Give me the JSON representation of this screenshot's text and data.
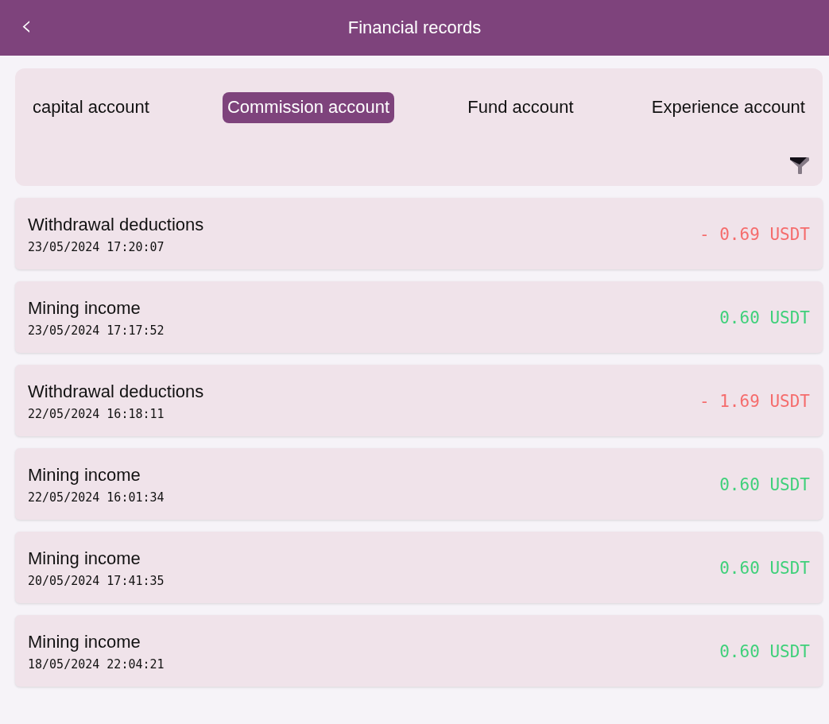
{
  "header": {
    "back": "‹",
    "title": "Financial records"
  },
  "tabs": [
    {
      "label": "capital account",
      "selected": false
    },
    {
      "label": "Commission account",
      "selected": true
    },
    {
      "label": "Fund account",
      "selected": false
    },
    {
      "label": "Experience account",
      "selected": false
    }
  ],
  "records": [
    {
      "title": "Withdrawal deductions",
      "date": "23/05/2024 17:20:07",
      "amount": "- 0.69 USDT",
      "kind": "debit"
    },
    {
      "title": "Mining income",
      "date": "23/05/2024 17:17:52",
      "amount": "0.60 USDT",
      "kind": "credit"
    },
    {
      "title": "Withdrawal deductions",
      "date": "22/05/2024 16:18:11",
      "amount": "- 1.69 USDT",
      "kind": "debit"
    },
    {
      "title": "Mining income",
      "date": "22/05/2024 16:01:34",
      "amount": "0.60 USDT",
      "kind": "credit"
    },
    {
      "title": "Mining income",
      "date": "20/05/2024 17:41:35",
      "amount": "0.60 USDT",
      "kind": "credit"
    },
    {
      "title": "Mining income",
      "date": "18/05/2024 22:04:21",
      "amount": "0.60 USDT",
      "kind": "credit"
    }
  ]
}
